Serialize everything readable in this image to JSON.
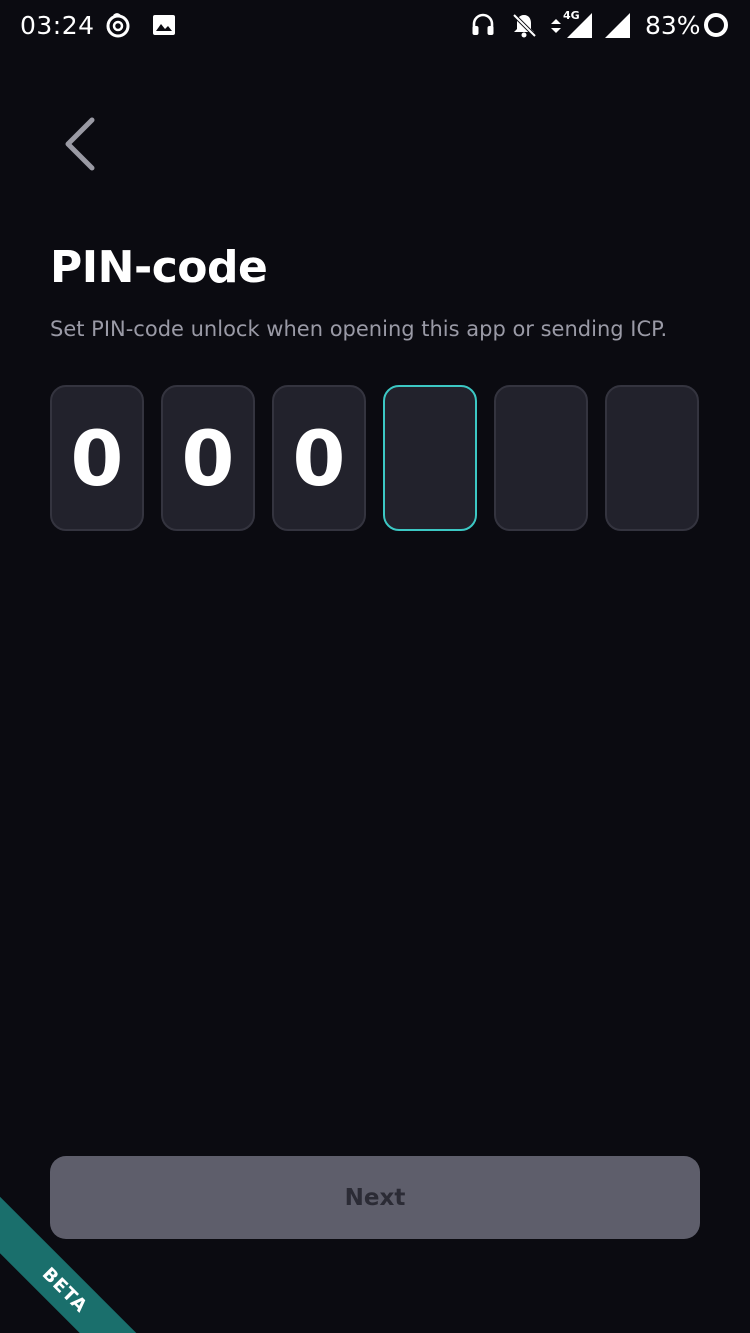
{
  "status_bar": {
    "time": "03:24",
    "battery_percent": "83%",
    "network": "4G",
    "icons": [
      "netease-music-icon",
      "image-icon",
      "headset-icon",
      "bell-off-icon",
      "data-arrows-icon",
      "signal-icon",
      "signal-icon",
      "battery-ring-icon"
    ]
  },
  "header": {
    "back_icon": "chevron-left-icon"
  },
  "main": {
    "title": "PIN-code",
    "subtitle": "Set PIN-code unlock when opening this app or sending ICP.",
    "pin": {
      "digits": [
        "0",
        "0",
        "0",
        "",
        "",
        ""
      ],
      "active_index": 3
    }
  },
  "footer": {
    "next_label": "Next"
  },
  "badge": {
    "beta_label": "BETA"
  },
  "colors": {
    "background": "#0b0b11",
    "box_fill": "#22222c",
    "active_border": "#3cc8c4",
    "button_disabled": "#5e5e6b",
    "beta_ribbon": "#1a6f6c"
  }
}
